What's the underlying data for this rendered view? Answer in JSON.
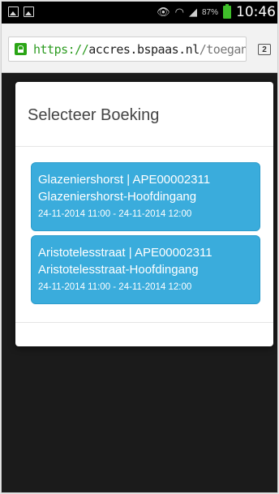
{
  "status_bar": {
    "battery_percent": "87%",
    "time": "10:46",
    "icons": [
      "image-icon",
      "gallery-icon",
      "eye-icon",
      "wifi-icon",
      "signal-icon",
      "battery-icon"
    ]
  },
  "browser": {
    "url_protocol": "https://",
    "url_host": "accres.bspaas.nl",
    "url_path": "/toegang",
    "tab_count": "2"
  },
  "modal": {
    "title": "Selecteer Boeking",
    "bookings": [
      {
        "line1": "Glazeniershorst | APE00002311",
        "line2": "Glazeniershorst-Hoofdingang",
        "line3": "24-11-2014 11:00 - 24-11-2014 12:00"
      },
      {
        "line1": "Aristotelesstraat | APE00002311",
        "line2": "Aristotelesstraat-Hoofdingang",
        "line3": "24-11-2014 11:00 - 24-11-2014 12:00"
      }
    ]
  },
  "colors": {
    "booking_bg": "#3aacdc",
    "url_green": "#2e9c22",
    "battery_green": "#3fbf2a"
  }
}
